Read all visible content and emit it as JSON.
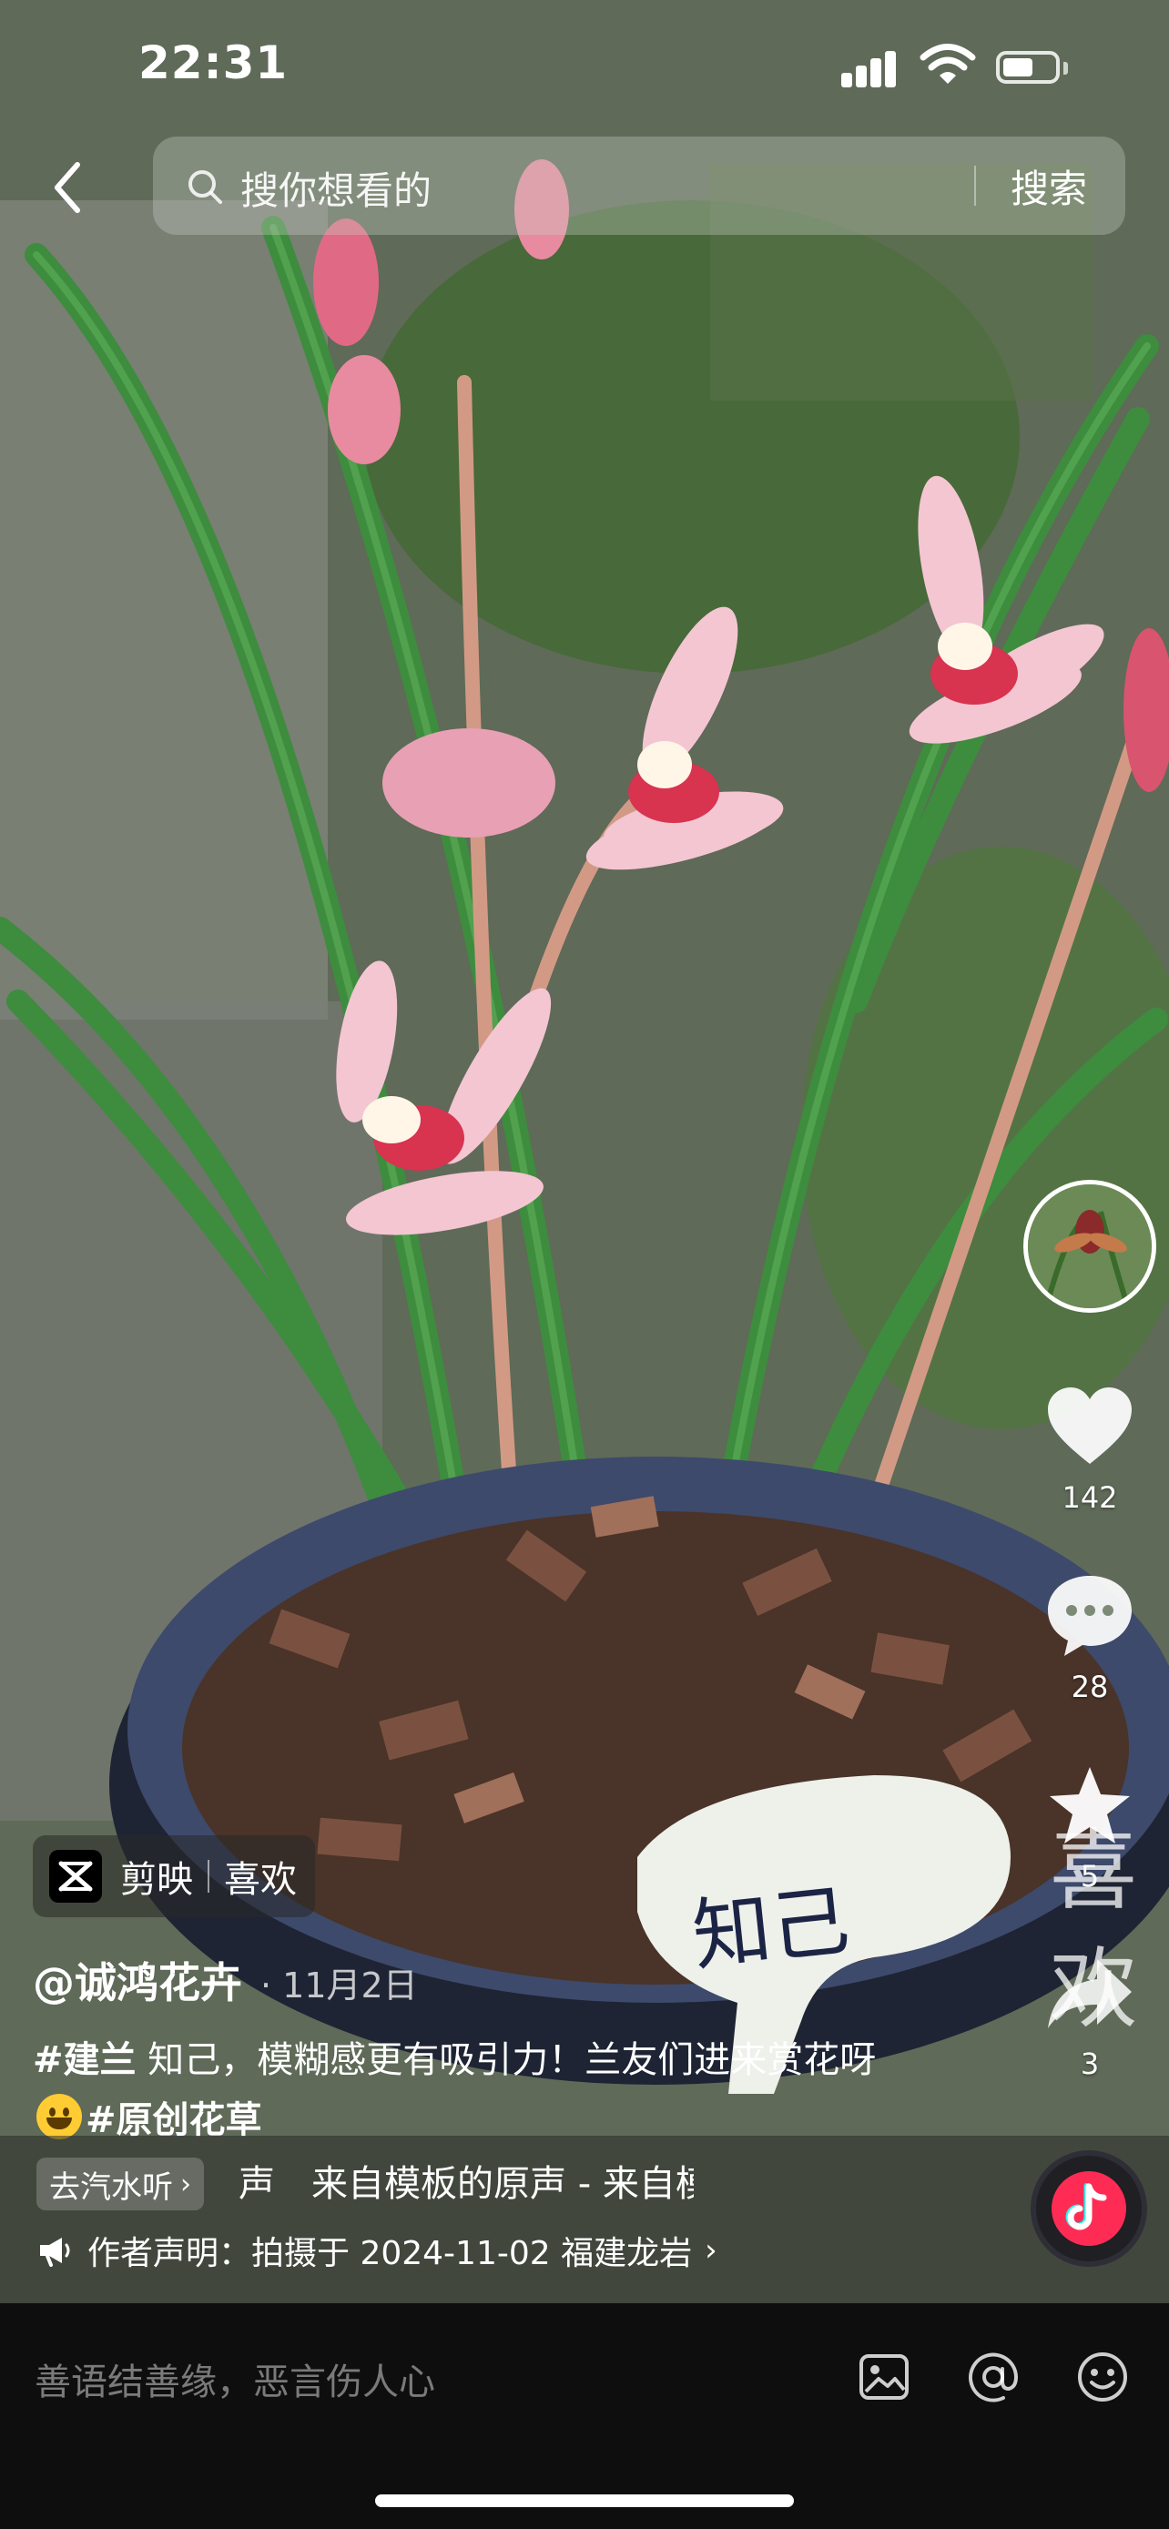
{
  "status_bar": {
    "time": "22:31"
  },
  "search": {
    "placeholder": "搜你想看的",
    "button_label": "搜索"
  },
  "rail": {
    "likes": "142",
    "comments": "28",
    "favorites": "5",
    "shares": "3"
  },
  "watermark_text": "喜欢",
  "video_overlay": {
    "plant_label": "知己"
  },
  "capcut_tag": {
    "app": "剪映",
    "action": "喜欢"
  },
  "post": {
    "author": "@诚鸿花卉",
    "date": "· 11月2日",
    "hashtag_1": "#建兰",
    "caption_text": " 知己，模糊感更有吸引力！兰友们进来赏花呀",
    "hashtag_2": "#原创花草"
  },
  "music": {
    "chip_label": "去汽水听",
    "text": "声　来自模板的原声 - 来自模板的原声"
  },
  "statement": "作者声明：拍摄于 2024-11-02 福建龙岩",
  "comment_input": {
    "placeholder": "善语结善缘，恶言伤人心"
  },
  "colors": {
    "accent": "#fe2c55",
    "leaf": "#3e8c3e",
    "petal": "#f3c6d2"
  }
}
